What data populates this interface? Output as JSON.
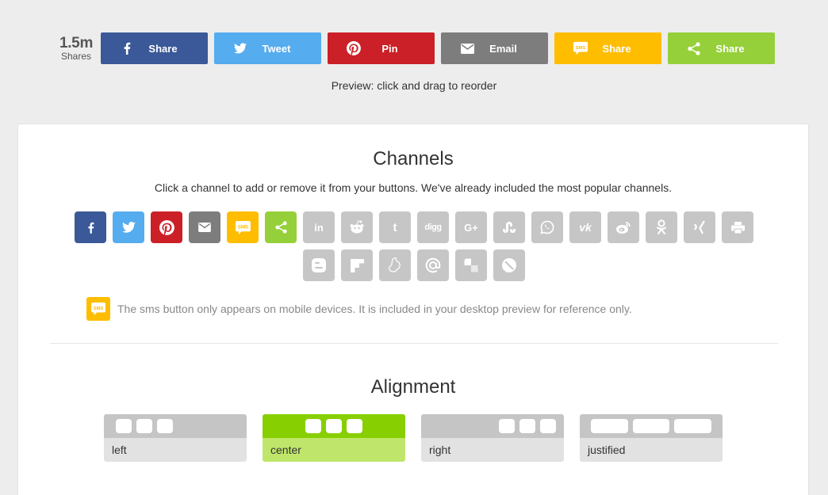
{
  "share_bar": {
    "count": "1.5m",
    "count_label": "Shares",
    "buttons": [
      {
        "label": "Share",
        "icon": "facebook-icon",
        "color": "#3b5998"
      },
      {
        "label": "Tweet",
        "icon": "twitter-icon",
        "color": "#55acee"
      },
      {
        "label": "Pin",
        "icon": "pinterest-icon",
        "color": "#cb2027"
      },
      {
        "label": "Email",
        "icon": "email-icon",
        "color": "#7d7d7d"
      },
      {
        "label": "Share",
        "icon": "sms-icon",
        "color": "#ffbd00"
      },
      {
        "label": "Share",
        "icon": "share-icon",
        "color": "#95d03a"
      }
    ]
  },
  "preview_note": "Preview: click and drag to reorder",
  "channels": {
    "title": "Channels",
    "subtitle": "Click a channel to add or remove it from your buttons. We've already included the most popular channels.",
    "sms_notice": "The sms button only appears on mobile devices. It is included in your desktop preview for reference only.",
    "active_color": "#3b5998",
    "inactive_color": "#c6c6c6",
    "items": [
      {
        "id": "facebook",
        "active": true,
        "color": "#3b5998"
      },
      {
        "id": "twitter",
        "active": true,
        "color": "#55acee"
      },
      {
        "id": "pinterest",
        "active": true,
        "color": "#cb2027"
      },
      {
        "id": "email",
        "active": true,
        "color": "#7d7d7d"
      },
      {
        "id": "sms",
        "active": true,
        "color": "#ffbd00"
      },
      {
        "id": "sharethis",
        "active": true,
        "color": "#95d03a"
      },
      {
        "id": "linkedin",
        "active": false,
        "glyph": "in"
      },
      {
        "id": "reddit",
        "active": false
      },
      {
        "id": "tumblr",
        "active": false,
        "glyph": "t"
      },
      {
        "id": "digg",
        "active": false,
        "glyph": "digg"
      },
      {
        "id": "googleplus",
        "active": false,
        "glyph": "G+"
      },
      {
        "id": "stumbleupon",
        "active": false
      },
      {
        "id": "whatsapp",
        "active": false
      },
      {
        "id": "vk",
        "active": false,
        "glyph": "vk"
      },
      {
        "id": "weibo",
        "active": false
      },
      {
        "id": "odnoklassniki",
        "active": false
      },
      {
        "id": "xing",
        "active": false
      },
      {
        "id": "print",
        "active": false
      },
      {
        "id": "blogger",
        "active": false
      },
      {
        "id": "flipboard",
        "active": false
      },
      {
        "id": "meneame",
        "active": false
      },
      {
        "id": "mailru",
        "active": false
      },
      {
        "id": "delicious",
        "active": false
      },
      {
        "id": "livejournal",
        "active": false
      }
    ]
  },
  "alignment": {
    "title": "Alignment",
    "selected": "center",
    "options": [
      {
        "id": "left",
        "label": "left"
      },
      {
        "id": "center",
        "label": "center"
      },
      {
        "id": "right",
        "label": "right"
      },
      {
        "id": "justified",
        "label": "justified"
      }
    ]
  }
}
